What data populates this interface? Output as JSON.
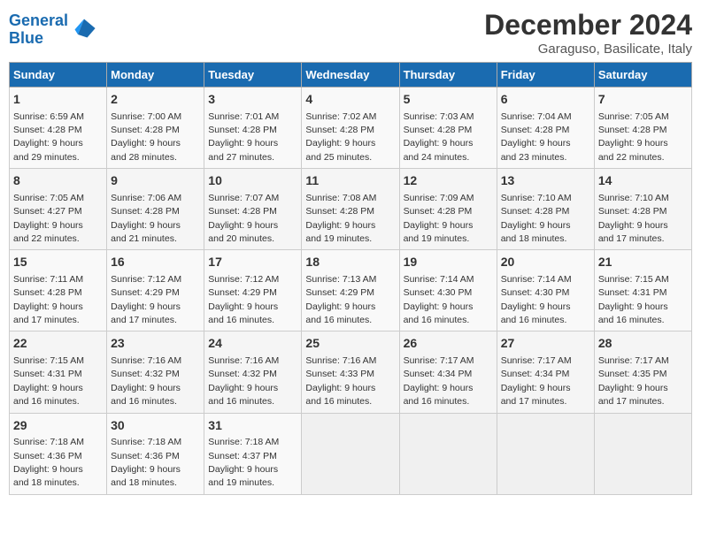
{
  "logo": {
    "line1": "General",
    "line2": "Blue"
  },
  "title": "December 2024",
  "subtitle": "Garaguso, Basilicate, Italy",
  "days_header": [
    "Sunday",
    "Monday",
    "Tuesday",
    "Wednesday",
    "Thursday",
    "Friday",
    "Saturday"
  ],
  "weeks": [
    [
      {
        "day": "1",
        "info": "Sunrise: 6:59 AM\nSunset: 4:28 PM\nDaylight: 9 hours\nand 29 minutes."
      },
      {
        "day": "2",
        "info": "Sunrise: 7:00 AM\nSunset: 4:28 PM\nDaylight: 9 hours\nand 28 minutes."
      },
      {
        "day": "3",
        "info": "Sunrise: 7:01 AM\nSunset: 4:28 PM\nDaylight: 9 hours\nand 27 minutes."
      },
      {
        "day": "4",
        "info": "Sunrise: 7:02 AM\nSunset: 4:28 PM\nDaylight: 9 hours\nand 25 minutes."
      },
      {
        "day": "5",
        "info": "Sunrise: 7:03 AM\nSunset: 4:28 PM\nDaylight: 9 hours\nand 24 minutes."
      },
      {
        "day": "6",
        "info": "Sunrise: 7:04 AM\nSunset: 4:28 PM\nDaylight: 9 hours\nand 23 minutes."
      },
      {
        "day": "7",
        "info": "Sunrise: 7:05 AM\nSunset: 4:28 PM\nDaylight: 9 hours\nand 22 minutes."
      }
    ],
    [
      {
        "day": "8",
        "info": "Sunrise: 7:05 AM\nSunset: 4:27 PM\nDaylight: 9 hours\nand 22 minutes."
      },
      {
        "day": "9",
        "info": "Sunrise: 7:06 AM\nSunset: 4:28 PM\nDaylight: 9 hours\nand 21 minutes."
      },
      {
        "day": "10",
        "info": "Sunrise: 7:07 AM\nSunset: 4:28 PM\nDaylight: 9 hours\nand 20 minutes."
      },
      {
        "day": "11",
        "info": "Sunrise: 7:08 AM\nSunset: 4:28 PM\nDaylight: 9 hours\nand 19 minutes."
      },
      {
        "day": "12",
        "info": "Sunrise: 7:09 AM\nSunset: 4:28 PM\nDaylight: 9 hours\nand 19 minutes."
      },
      {
        "day": "13",
        "info": "Sunrise: 7:10 AM\nSunset: 4:28 PM\nDaylight: 9 hours\nand 18 minutes."
      },
      {
        "day": "14",
        "info": "Sunrise: 7:10 AM\nSunset: 4:28 PM\nDaylight: 9 hours\nand 17 minutes."
      }
    ],
    [
      {
        "day": "15",
        "info": "Sunrise: 7:11 AM\nSunset: 4:28 PM\nDaylight: 9 hours\nand 17 minutes."
      },
      {
        "day": "16",
        "info": "Sunrise: 7:12 AM\nSunset: 4:29 PM\nDaylight: 9 hours\nand 17 minutes."
      },
      {
        "day": "17",
        "info": "Sunrise: 7:12 AM\nSunset: 4:29 PM\nDaylight: 9 hours\nand 16 minutes."
      },
      {
        "day": "18",
        "info": "Sunrise: 7:13 AM\nSunset: 4:29 PM\nDaylight: 9 hours\nand 16 minutes."
      },
      {
        "day": "19",
        "info": "Sunrise: 7:14 AM\nSunset: 4:30 PM\nDaylight: 9 hours\nand 16 minutes."
      },
      {
        "day": "20",
        "info": "Sunrise: 7:14 AM\nSunset: 4:30 PM\nDaylight: 9 hours\nand 16 minutes."
      },
      {
        "day": "21",
        "info": "Sunrise: 7:15 AM\nSunset: 4:31 PM\nDaylight: 9 hours\nand 16 minutes."
      }
    ],
    [
      {
        "day": "22",
        "info": "Sunrise: 7:15 AM\nSunset: 4:31 PM\nDaylight: 9 hours\nand 16 minutes."
      },
      {
        "day": "23",
        "info": "Sunrise: 7:16 AM\nSunset: 4:32 PM\nDaylight: 9 hours\nand 16 minutes."
      },
      {
        "day": "24",
        "info": "Sunrise: 7:16 AM\nSunset: 4:32 PM\nDaylight: 9 hours\nand 16 minutes."
      },
      {
        "day": "25",
        "info": "Sunrise: 7:16 AM\nSunset: 4:33 PM\nDaylight: 9 hours\nand 16 minutes."
      },
      {
        "day": "26",
        "info": "Sunrise: 7:17 AM\nSunset: 4:34 PM\nDaylight: 9 hours\nand 16 minutes."
      },
      {
        "day": "27",
        "info": "Sunrise: 7:17 AM\nSunset: 4:34 PM\nDaylight: 9 hours\nand 17 minutes."
      },
      {
        "day": "28",
        "info": "Sunrise: 7:17 AM\nSunset: 4:35 PM\nDaylight: 9 hours\nand 17 minutes."
      }
    ],
    [
      {
        "day": "29",
        "info": "Sunrise: 7:18 AM\nSunset: 4:36 PM\nDaylight: 9 hours\nand 18 minutes."
      },
      {
        "day": "30",
        "info": "Sunrise: 7:18 AM\nSunset: 4:36 PM\nDaylight: 9 hours\nand 18 minutes."
      },
      {
        "day": "31",
        "info": "Sunrise: 7:18 AM\nSunset: 4:37 PM\nDaylight: 9 hours\nand 19 minutes."
      },
      null,
      null,
      null,
      null
    ]
  ]
}
